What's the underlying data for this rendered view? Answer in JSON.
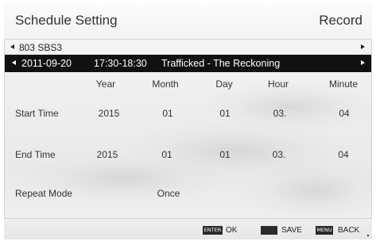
{
  "header": {
    "title": "Schedule Setting",
    "right_label": "Record"
  },
  "channel": {
    "label": "803 SBS3",
    "left_icon": "triangle-left-icon",
    "right_icon": "triangle-right-icon"
  },
  "program": {
    "date": "2011-09-20",
    "time": "17:30-18:30",
    "title": "Trafficked - The Reckoning"
  },
  "columns": [
    "Year",
    "Month",
    "Day",
    "Hour",
    "Minute"
  ],
  "start_time": {
    "label": "Start Time",
    "year": "2015",
    "month": "01",
    "day": "01",
    "hour": "03.",
    "minute": "04"
  },
  "end_time": {
    "label": "End Time",
    "year": "2015",
    "month": "01",
    "day": "01",
    "hour": "03.",
    "minute": "04"
  },
  "repeat": {
    "label": "Repeat Mode",
    "value": "Once"
  },
  "footer": {
    "enter_key": "ENTER",
    "enter_label": "OK",
    "save_label": "SAVE",
    "menu_key": "MENU",
    "menu_label": "BACK"
  },
  "colors": {
    "selection_bar": "#111111",
    "text": "#333333"
  }
}
